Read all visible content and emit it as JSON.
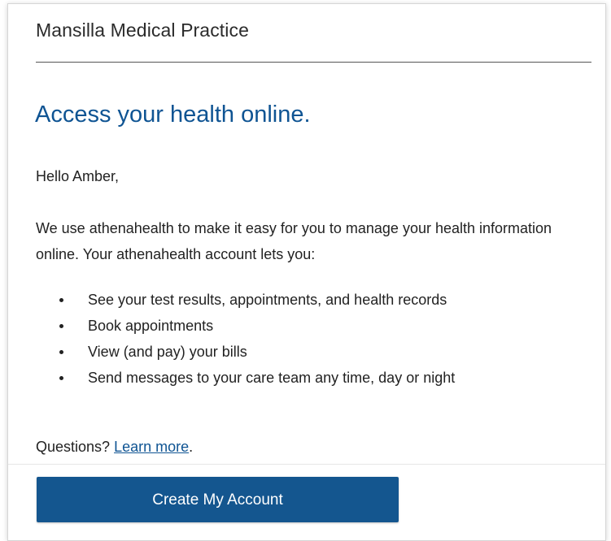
{
  "header": {
    "practice_name": "Mansilla Medical Practice"
  },
  "main": {
    "headline": "Access your health online.",
    "greeting": "Hello Amber,",
    "intro": "We use athenahealth to make it easy for you to manage your health information online. Your athenahealth account lets you:",
    "benefits": [
      "See your test results, appointments, and health records",
      "Book appointments",
      "View (and pay) your bills",
      "Send messages to your care team any time, day or night"
    ],
    "questions_prefix": "Questions?",
    "learn_more_link": "Learn more",
    "questions_suffix": "."
  },
  "footer": {
    "cta_label": "Create My Account"
  },
  "colors": {
    "accent": "#0f5493",
    "button": "#14568f",
    "text": "#222222"
  }
}
